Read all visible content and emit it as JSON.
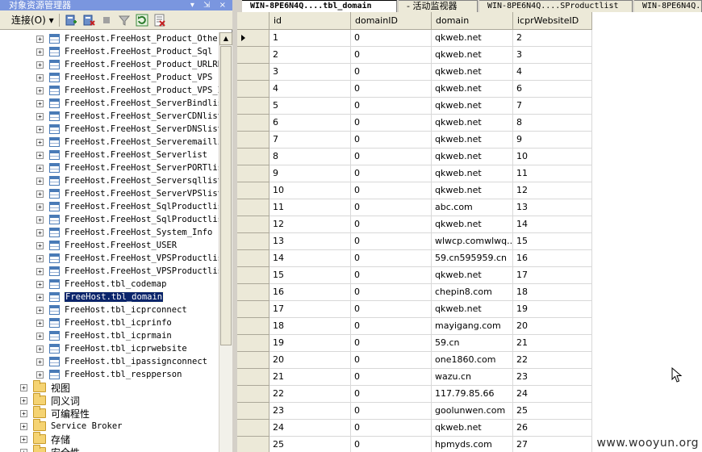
{
  "explorer": {
    "title": "对象资源管理器",
    "title_icons": "▾ ⇲ ×",
    "toolbar": {
      "connect_label": "连接(O)",
      "connect_arrow": "▾"
    },
    "tree_items": [
      {
        "label": "FreeHost.FreeHost_Product_Other"
      },
      {
        "label": "FreeHost.FreeHost_Product_Sql"
      },
      {
        "label": "FreeHost.FreeHost_Product_URLRE"
      },
      {
        "label": "FreeHost.FreeHost_Product_VPS"
      },
      {
        "label": "FreeHost.FreeHost_Product_VPS_II"
      },
      {
        "label": "FreeHost.FreeHost_ServerBindlist"
      },
      {
        "label": "FreeHost.FreeHost_ServerCDNlist"
      },
      {
        "label": "FreeHost.FreeHost_ServerDNSlist"
      },
      {
        "label": "FreeHost.FreeHost_Serveremaillist"
      },
      {
        "label": "FreeHost.FreeHost_Serverlist"
      },
      {
        "label": "FreeHost.FreeHost_ServerPORTlist"
      },
      {
        "label": "FreeHost.FreeHost_Serversqllist"
      },
      {
        "label": "FreeHost.FreeHost_ServerVPSlist"
      },
      {
        "label": "FreeHost.FreeHost_SqlProductlist"
      },
      {
        "label": "FreeHost.FreeHost_SqlProductlist"
      },
      {
        "label": "FreeHost.FreeHost_System_Info"
      },
      {
        "label": "FreeHost.FreeHost_USER"
      },
      {
        "label": "FreeHost.FreeHost_VPSProductlist"
      },
      {
        "label": "FreeHost.FreeHost_VPSProductlist"
      },
      {
        "label": "FreeHost.tbl_codemap"
      },
      {
        "label": "FreeHost.tbl_domain",
        "selected": true
      },
      {
        "label": "FreeHost.tbl_icprconnect"
      },
      {
        "label": "FreeHost.tbl_icprinfo"
      },
      {
        "label": "FreeHost.tbl_icprmain"
      },
      {
        "label": "FreeHost.tbl_icprwebsite"
      },
      {
        "label": "FreeHost.tbl_ipassignconnect"
      },
      {
        "label": "FreeHost.tbl_respperson"
      }
    ],
    "folders": [
      {
        "label": "视图"
      },
      {
        "label": "同义词"
      },
      {
        "label": "可编程性"
      },
      {
        "label": "Service Broker"
      },
      {
        "label": "存储"
      },
      {
        "label": "安全性"
      }
    ]
  },
  "tabs": [
    {
      "label": "WIN-8PE6N4Q....tbl_domain",
      "active": true
    },
    {
      "label": "- 活动监视器",
      "active": false
    },
    {
      "label": "WIN-8PE6N4Q....SProductlist",
      "active": false
    },
    {
      "label": "WIN-8PE6N4Q.",
      "active": false
    }
  ],
  "grid": {
    "columns": [
      "id",
      "domainID",
      "domain",
      "icprWebsiteID"
    ],
    "rows": [
      [
        "1",
        "0",
        "qkweb.net",
        "2"
      ],
      [
        "2",
        "0",
        "qkweb.net",
        "3"
      ],
      [
        "3",
        "0",
        "qkweb.net",
        "4"
      ],
      [
        "4",
        "0",
        "qkweb.net",
        "6"
      ],
      [
        "5",
        "0",
        "qkweb.net",
        "7"
      ],
      [
        "6",
        "0",
        "qkweb.net",
        "8"
      ],
      [
        "7",
        "0",
        "qkweb.net",
        "9"
      ],
      [
        "8",
        "0",
        "qkweb.net",
        "10"
      ],
      [
        "9",
        "0",
        "qkweb.net",
        "11"
      ],
      [
        "10",
        "0",
        "qkweb.net",
        "12"
      ],
      [
        "11",
        "0",
        "abc.com",
        "13"
      ],
      [
        "12",
        "0",
        "qkweb.net",
        "14"
      ],
      [
        "13",
        "0",
        "wlwcp.comwlwq....",
        "15"
      ],
      [
        "14",
        "0",
        "59.cn595959.cn",
        "16"
      ],
      [
        "15",
        "0",
        "qkweb.net",
        "17"
      ],
      [
        "16",
        "0",
        "chepin8.com",
        "18"
      ],
      [
        "17",
        "0",
        "qkweb.net",
        "19"
      ],
      [
        "18",
        "0",
        "mayigang.com",
        "20"
      ],
      [
        "19",
        "0",
        "59.cn",
        "21"
      ],
      [
        "20",
        "0",
        "one1860.com",
        "22"
      ],
      [
        "21",
        "0",
        "wazu.cn",
        "23"
      ],
      [
        "22",
        "0",
        "117.79.85.66",
        "24"
      ],
      [
        "23",
        "0",
        "goolunwen.com",
        "25"
      ],
      [
        "24",
        "0",
        "qkweb.net",
        "26"
      ],
      [
        "25",
        "0",
        "hpmyds.com",
        "27"
      ]
    ]
  },
  "watermark": "www.wooyun.org",
  "colors": {
    "title_bar": "#7a96df",
    "selection": "#0a246a",
    "chrome": "#d4d0c8",
    "header": "#ece9d8"
  }
}
